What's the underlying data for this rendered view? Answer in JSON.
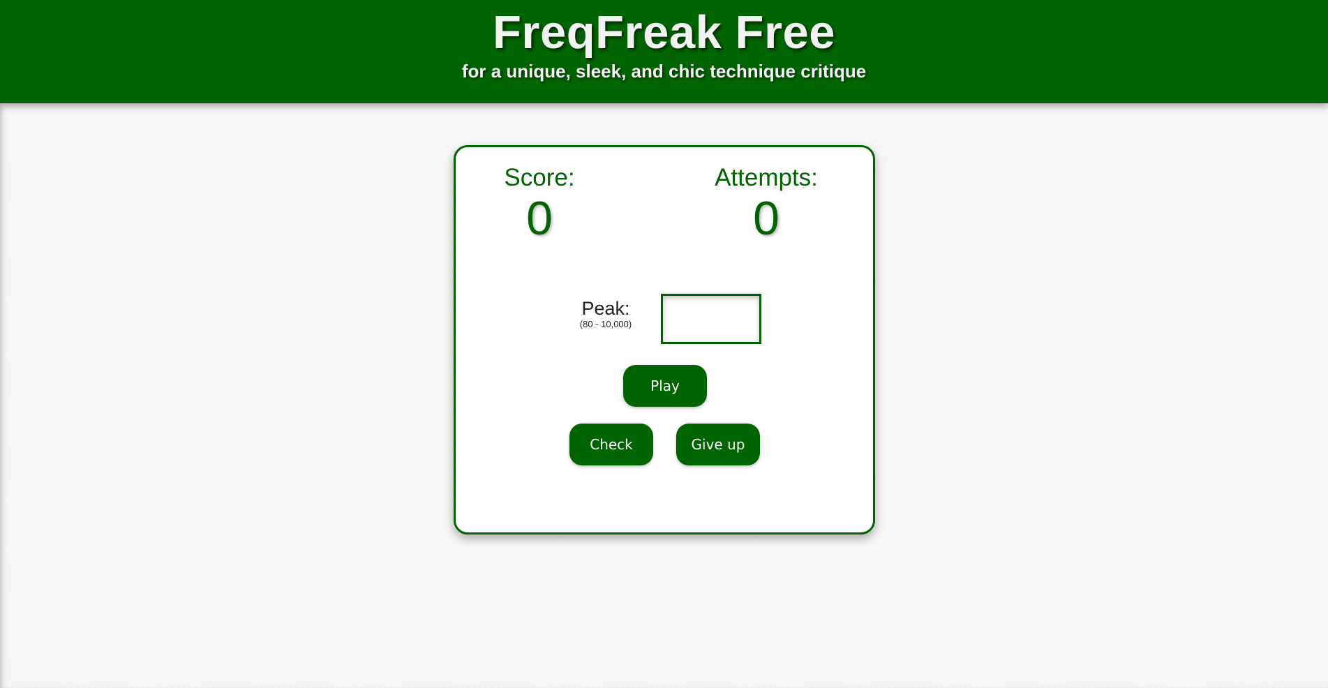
{
  "header": {
    "title": "FreqFreak Free",
    "subtitle": "for a unique, sleek, and chic technique critique"
  },
  "stats": {
    "score_label": "Score:",
    "score_value": "0",
    "attempts_label": "Attempts:",
    "attempts_value": "0"
  },
  "peak": {
    "label": "Peak:",
    "range": "(80 - 10,000)",
    "value": ""
  },
  "buttons": {
    "play": "Play",
    "check": "Check",
    "give_up": "Give up"
  },
  "colors": {
    "brand": "#006400",
    "background": "#f7f7f7",
    "card": "#ffffff"
  }
}
